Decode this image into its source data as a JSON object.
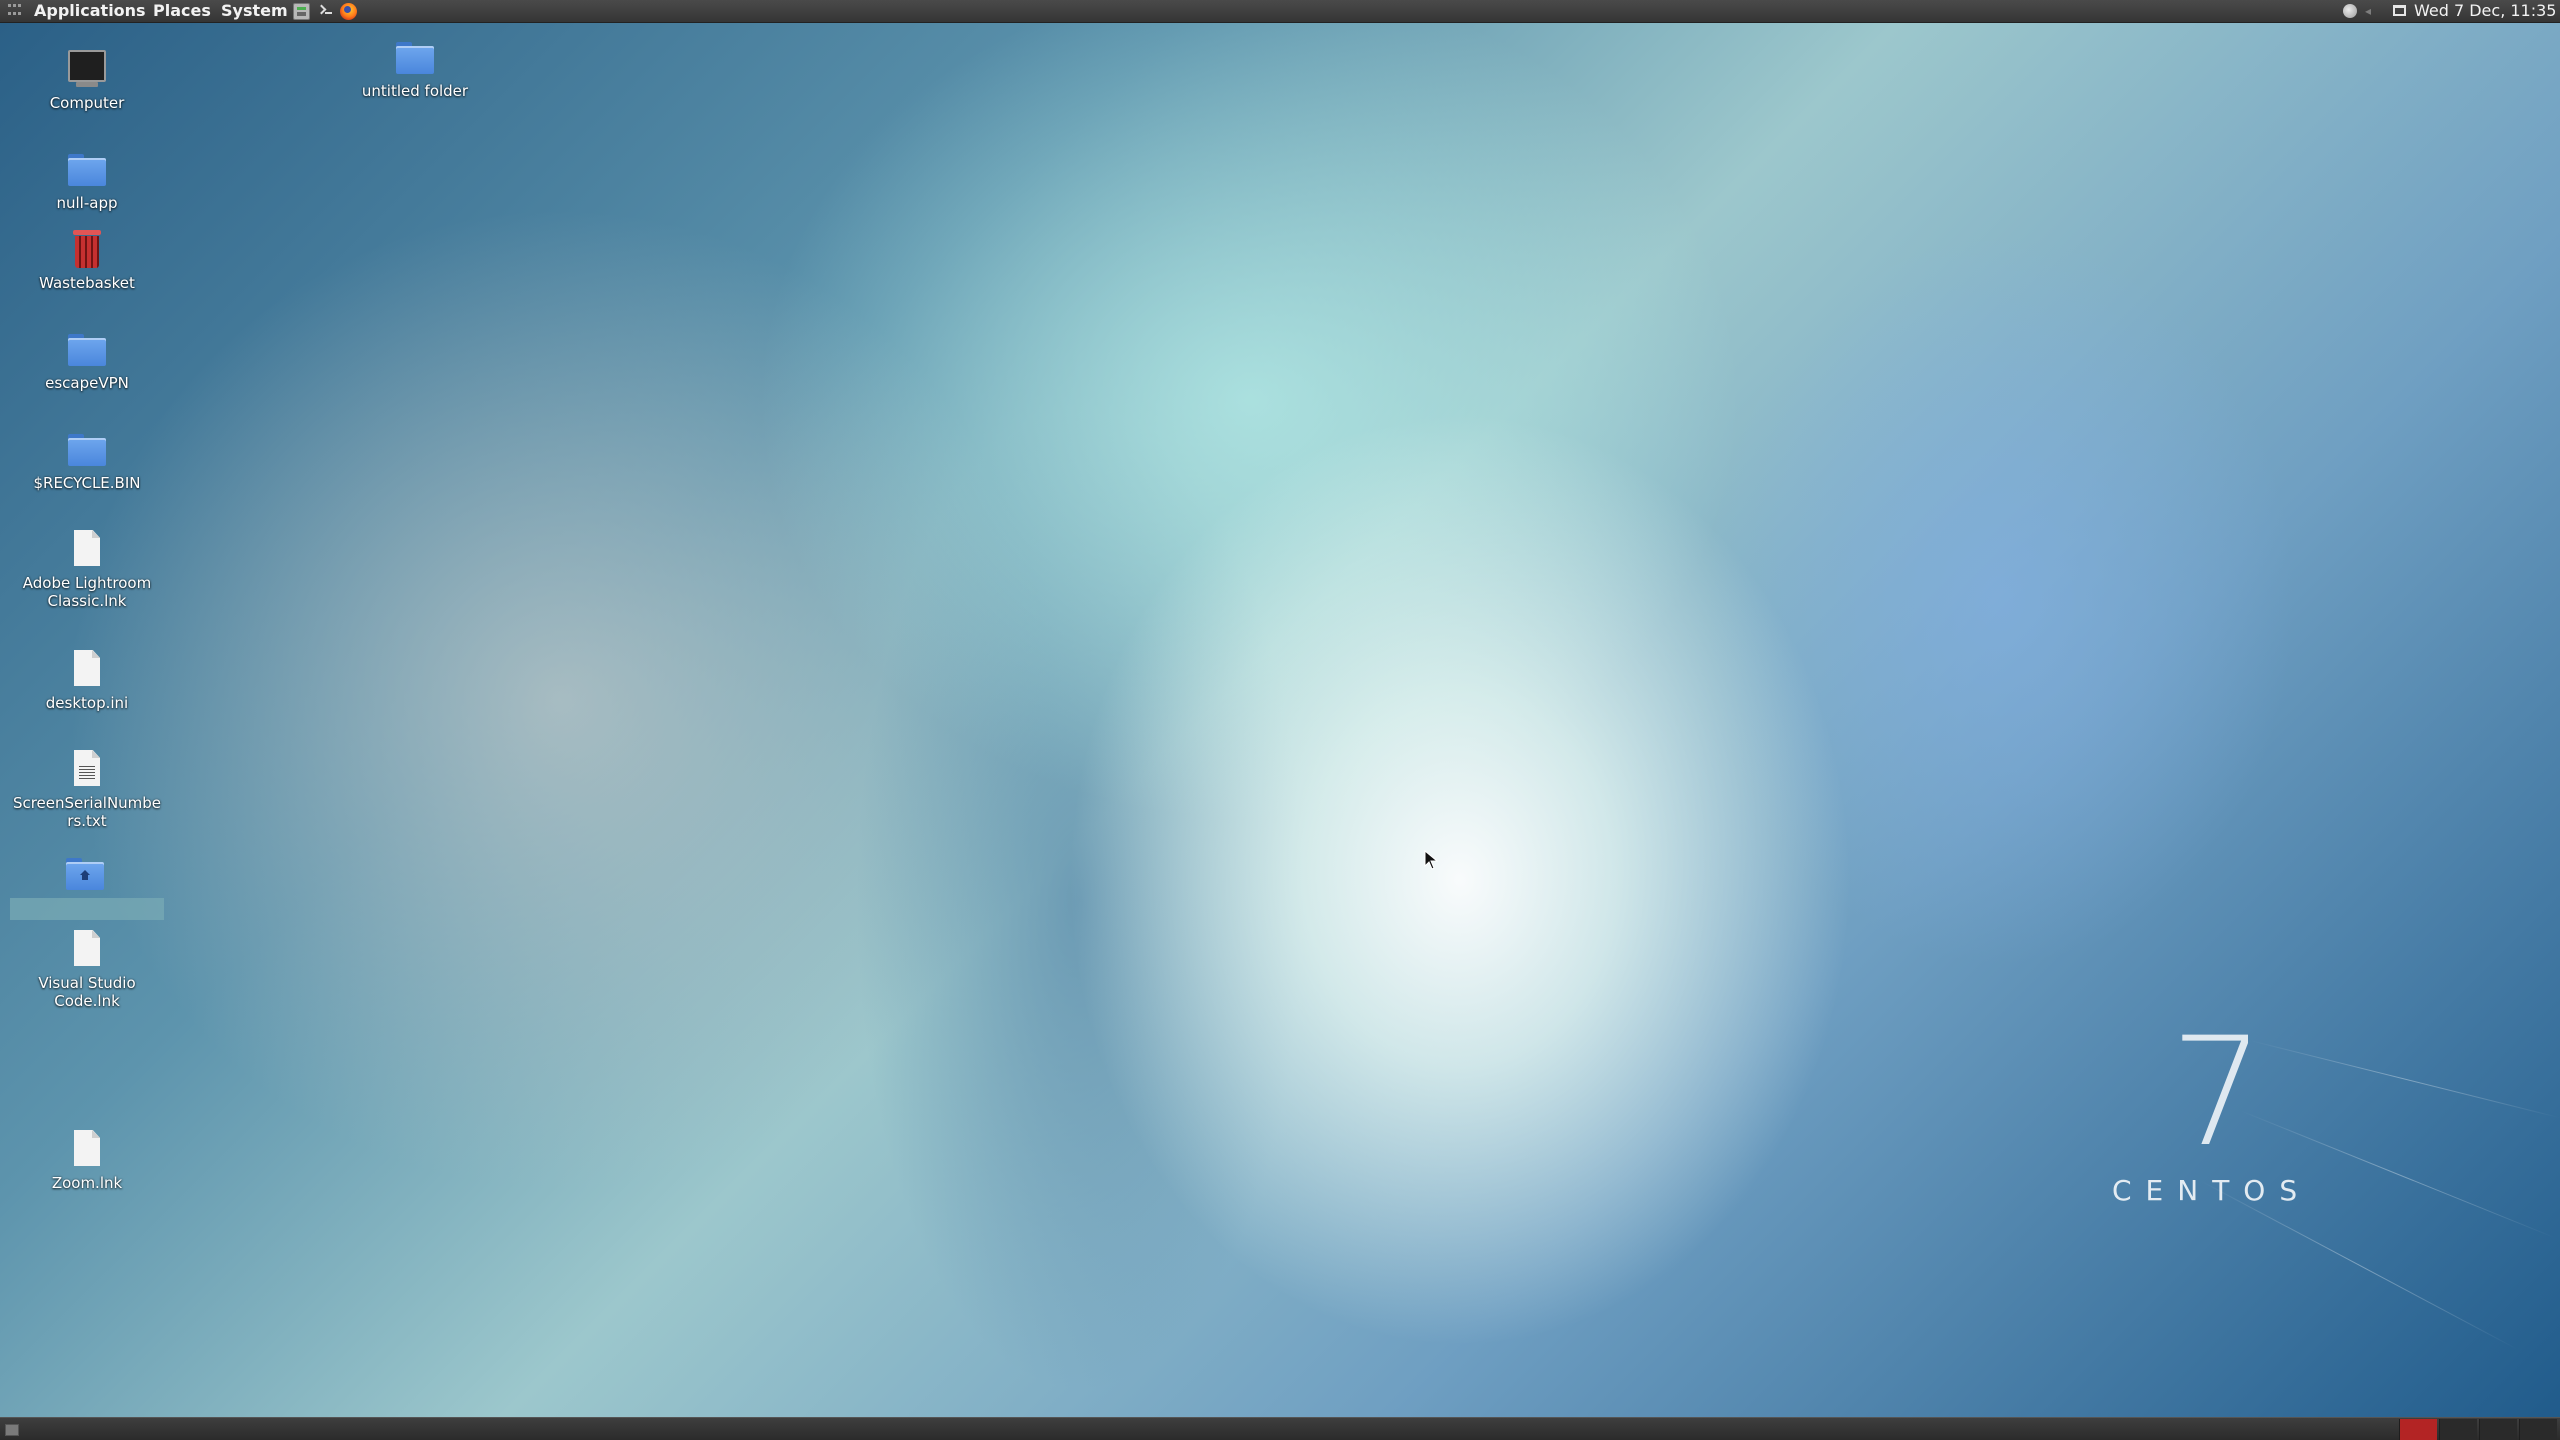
{
  "top_panel": {
    "menus": {
      "applications": "Applications",
      "places": "Places",
      "system": "System"
    },
    "launchers": [
      "files-icon",
      "terminal-icon",
      "firefox-icon"
    ],
    "tray": [
      "status-icon",
      "volume-icon",
      "window-list-icon"
    ],
    "clock": "Wed  7 Dec, 11:35"
  },
  "desktop": {
    "icons": {
      "computer": {
        "label": "Computer",
        "icon": "computer-icon"
      },
      "untitled_folder": {
        "label": "untitled folder",
        "icon": "folder-icon"
      },
      "null_app": {
        "label": "null-app",
        "icon": "folder-icon"
      },
      "wastebasket": {
        "label": "Wastebasket",
        "icon": "trash-icon"
      },
      "escapevpn": {
        "label": "escapeVPN",
        "icon": "folder-icon"
      },
      "recycle_bin": {
        "label": "$RECYCLE.BIN",
        "icon": "folder-icon"
      },
      "lightroom": {
        "label": "Adobe Lightroom Classic.lnk",
        "icon": "file-icon"
      },
      "desktop_ini": {
        "label": "desktop.ini",
        "icon": "file-icon"
      },
      "serials": {
        "label": "ScreenSerialNumbers.txt",
        "icon": "text-file-icon"
      },
      "home": {
        "label": "",
        "icon": "home-folder-icon"
      },
      "vscode": {
        "label": "Visual Studio Code.lnk",
        "icon": "file-icon"
      },
      "zoom": {
        "label": "Zoom.lnk",
        "icon": "file-icon"
      }
    },
    "branding": {
      "version": "7",
      "wordmark": "CENTOS"
    }
  },
  "bottom_panel": {
    "workspace_count": 4,
    "active_workspace": 1
  },
  "colors": {
    "panel_bg": "#3a3a3a",
    "active_workspace": "#b32424",
    "folder_blue": "#4a86dc"
  }
}
